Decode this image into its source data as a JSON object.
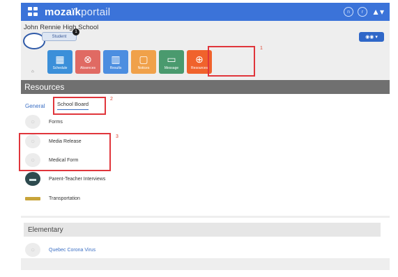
{
  "brand": {
    "name_bold": "mozaïk",
    "name_light": "portail"
  },
  "topbar": {
    "icon_a": "n",
    "icon_b": "r",
    "user_icon": "▲▾"
  },
  "school": {
    "name": "John Rennie High School"
  },
  "student": {
    "label": "Student",
    "badge": "1"
  },
  "people_button": {
    "label": "▾"
  },
  "tiles": [
    {
      "label": "Schedule",
      "icon": "calendar-icon",
      "glyph": "▦",
      "color": "#3b8fd9"
    },
    {
      "label": "Absences",
      "icon": "alarm-icon",
      "glyph": "⊗",
      "color": "#e06a63"
    },
    {
      "label": "Results",
      "icon": "bar-chart-icon",
      "glyph": "▥",
      "color": "#4c8ee0"
    },
    {
      "label": "Notices",
      "icon": "folder-icon",
      "glyph": "▢",
      "color": "#f0a14a"
    },
    {
      "label": "Message",
      "icon": "message-icon",
      "glyph": "▭",
      "color": "#4a9a6e"
    },
    {
      "label": "Resources",
      "icon": "resources-icon",
      "glyph": "⊕",
      "color": "#f0622c"
    }
  ],
  "small_mark": "⌂",
  "annotations": {
    "one": "1",
    "two": "2",
    "three": "3"
  },
  "resources": {
    "title": "Resources",
    "tabs": {
      "general": "General",
      "school_board": "School Board"
    },
    "items": [
      {
        "label": "Forms",
        "icon": "document-icon"
      },
      {
        "label": "Media Release",
        "icon": "document-icon"
      },
      {
        "label": "Medical Form",
        "icon": "document-icon"
      },
      {
        "label": "Parent-Teacher Interviews",
        "icon": "meeting-icon"
      },
      {
        "label": "Transportation",
        "icon": "bus-icon"
      }
    ]
  },
  "elementary": {
    "title": "Elementary",
    "items": [
      {
        "label": "Quebec Corona Virus",
        "icon": "document-icon"
      }
    ]
  },
  "colors": {
    "topbar": "#3b73d9",
    "highlight": "#e0353b",
    "link": "#3b6fc4"
  }
}
